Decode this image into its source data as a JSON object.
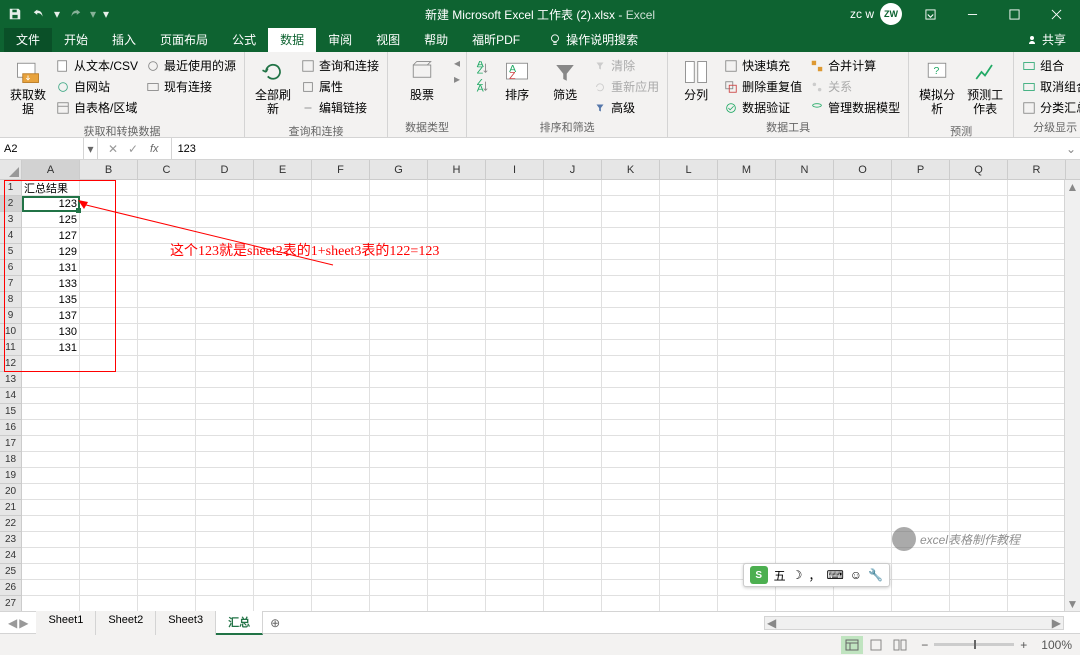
{
  "title": {
    "filename": "新建 Microsoft Excel 工作表 (2).xlsx",
    "app": "Excel"
  },
  "user": {
    "name": "zc w",
    "initials": "ZW"
  },
  "tabs": {
    "file": "文件",
    "home": "开始",
    "insert": "插入",
    "layout": "页面布局",
    "formulas": "公式",
    "data": "数据",
    "review": "审阅",
    "view": "视图",
    "help": "帮助",
    "pdf": "福昕PDF",
    "tellme": "操作说明搜索",
    "share": "共享"
  },
  "ribbon": {
    "getdata": {
      "label": "获取数据",
      "g": "获取和转换数据",
      "csv": "从文本/CSV",
      "recent": "最近使用的源",
      "web": "自网站",
      "conn": "现有连接",
      "table": "自表格/区域"
    },
    "query": {
      "refresh": "全部刷新",
      "g": "查询和连接",
      "qc": "查询和连接",
      "prop": "属性",
      "edit": "编辑链接"
    },
    "types": {
      "stock": "股票",
      "g": "数据类型"
    },
    "sort": {
      "sort": "排序",
      "filter": "筛选",
      "g": "排序和筛选",
      "clear": "清除",
      "reapply": "重新应用",
      "adv": "高级"
    },
    "tools": {
      "ttc": "分列",
      "g": "数据工具",
      "flash": "快速填充",
      "dup": "删除重复值",
      "valid": "数据验证",
      "consol": "合并计算",
      "rel": "关系",
      "model": "管理数据模型"
    },
    "forecast": {
      "wia": "模拟分析",
      "fs": "预测工作表",
      "g": "预测"
    },
    "outline": {
      "group": "组合",
      "ungroup": "取消组合",
      "sub": "分类汇总",
      "g": "分级显示"
    }
  },
  "namebox": "A2",
  "formula": "123",
  "cols": [
    "A",
    "B",
    "C",
    "D",
    "E",
    "F",
    "G",
    "H",
    "I",
    "J",
    "K",
    "L",
    "M",
    "N",
    "O",
    "P",
    "Q",
    "R"
  ],
  "data": {
    "A1": "汇总结果",
    "A2": "123",
    "A3": "125",
    "A4": "127",
    "A5": "129",
    "A6": "131",
    "A7": "133",
    "A8": "135",
    "A9": "137",
    "A10": "130",
    "A11": "131"
  },
  "annotation": "这个123就是sheet2表的1+sheet3表的122=123",
  "sheets": [
    "Sheet1",
    "Sheet2",
    "Sheet3",
    "汇总"
  ],
  "activeSheet": "汇总",
  "ime": "五",
  "zoom": "100%",
  "watermark": "excel表格制作教程"
}
